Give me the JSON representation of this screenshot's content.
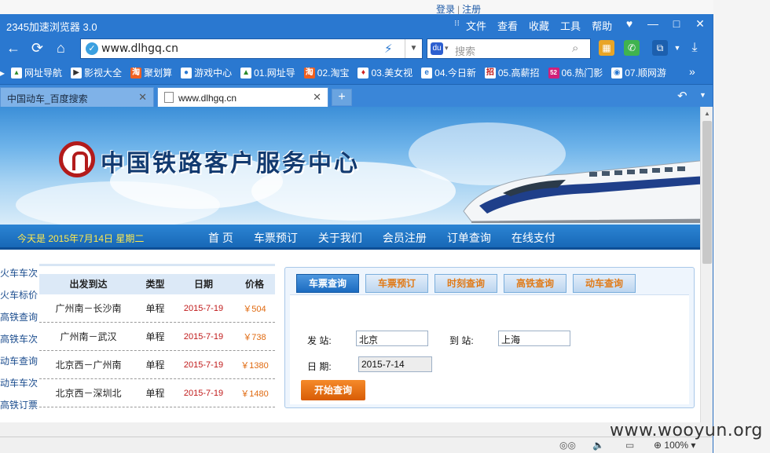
{
  "desktop": {
    "login": "登录",
    "register": "注册",
    "watermark": "www.wooyun.org"
  },
  "browser": {
    "title": "2345加速浏览器 3.0",
    "menu": [
      "文件",
      "查看",
      "收藏",
      "工具",
      "帮助"
    ],
    "window_buttons": [
      "—",
      "□",
      "✕"
    ],
    "url": "www.dlhgq.cn",
    "search_placeholder": "搜索",
    "bookmarks": [
      "网址导航",
      "影视大全",
      "聚划算",
      "游戏中心",
      "01.网址导",
      "02.淘宝",
      "03.美女视",
      "04.今日新",
      "05.高薪招",
      "06.热门影",
      "07.顺网游"
    ],
    "tabs": [
      {
        "label": "中国动车_百度搜索",
        "active": false
      },
      {
        "label": "www.dlhgq.cn",
        "active": true
      }
    ],
    "zoom": "100%"
  },
  "site": {
    "title": "中国铁路客户服务中心",
    "today": "今天是 2015年7月14日 星期二",
    "nav": [
      "首 页",
      "车票预订",
      "关于我们",
      "会员注册",
      "订单查询",
      "在线支付"
    ],
    "left_links": [
      "火车车次",
      "火车标价",
      "高铁查询",
      "高铁车次",
      "动车查询",
      "动车车次",
      "高铁订票"
    ],
    "price_table": {
      "headers": [
        "出发到达",
        "类型",
        "日期",
        "价格"
      ],
      "rows": [
        [
          "广州南－长沙南",
          "单程",
          "2015-7-19",
          "￥504"
        ],
        [
          "广州南－武汉",
          "单程",
          "2015-7-19",
          "￥738"
        ],
        [
          "北京西－广州南",
          "单程",
          "2015-7-19",
          "￥1380"
        ],
        [
          "北京西－深圳北",
          "单程",
          "2015-7-19",
          "￥1480"
        ]
      ]
    },
    "query": {
      "tabs": [
        "车票查询",
        "车票预订",
        "时刻查询",
        "高铁查询",
        "动车查询"
      ],
      "from_label": "发 站:",
      "from_value": "北京",
      "to_label": "到 站:",
      "to_value": "上海",
      "date_label": "日 期:",
      "date_value": "2015-7-14",
      "submit": "开始查询"
    }
  },
  "colors": {
    "chrome_blue": "#2a78d0",
    "nav_blue": "#1565b4",
    "brand_red": "#b31b1b",
    "price_orange": "#e06a10",
    "date_red": "#c01a1a"
  }
}
